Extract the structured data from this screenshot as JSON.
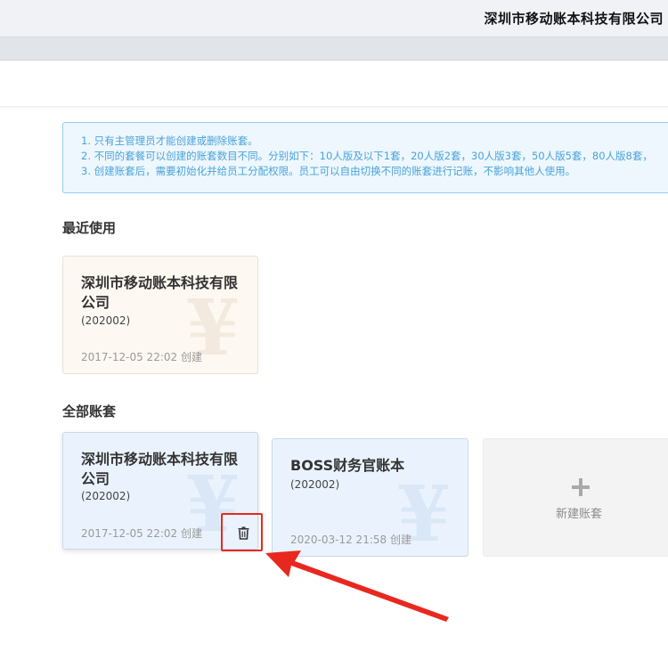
{
  "header": {
    "company_title": "深圳市移动账本科技有限公司"
  },
  "notice": {
    "lines": [
      "1. 只有主管理员才能创建或删除账套。",
      "2. 不同的套餐可以创建的账套数目不同。分别如下：10人版及以下1套，20人版2套，30人版3套，50人版5套，80人版8套，",
      "3. 创建账套后，需要初始化并给员工分配权限。员工可以自由切换不同的账套进行记账，不影响其他人使用。"
    ]
  },
  "recent": {
    "title": "最近使用",
    "cards": [
      {
        "name": "深圳市移动账本科技有限公司",
        "code": "(202002)",
        "date": "2017-12-05 22:02 创建",
        "watermark": "¥"
      }
    ]
  },
  "all": {
    "title": "全部账套",
    "cards": [
      {
        "name": "深圳市移动账本科技有限公司",
        "code": "(202002)",
        "date": "2017-12-05 22:02 创建",
        "watermark": "¥"
      },
      {
        "name": "BOSS财务官账本",
        "code": "(202002)",
        "date": "2020-03-12 21:58 创建",
        "watermark": "¥"
      }
    ],
    "new_label": "新建账套"
  },
  "icons": {
    "delete": "trash-icon",
    "new": "plus-icon"
  },
  "colors": {
    "highlight": "#e8281f",
    "notice_text": "#4aa3d9",
    "notice_border": "#8fd0f1"
  }
}
